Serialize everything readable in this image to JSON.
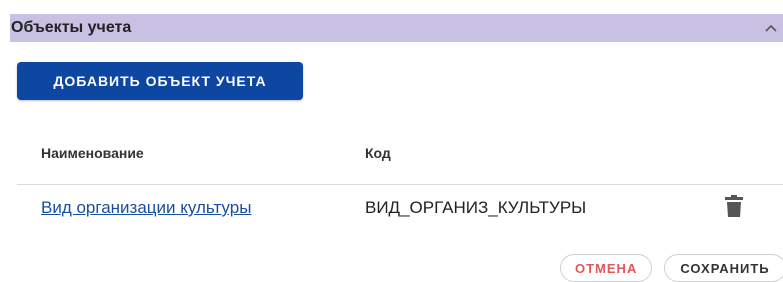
{
  "section": {
    "title": "Объекты учета",
    "collapse_icon": "chevron-up-icon"
  },
  "actions": {
    "add_label": "ДОБАВИТЬ ОБЪЕКТ УЧЕТА"
  },
  "table": {
    "columns": [
      "Наименование",
      "Код"
    ],
    "rows": [
      {
        "name": "Вид организации культуры",
        "code": "ВИД_ОРГАНИЗ_КУЛЬТУРЫ",
        "action_icon": "trash-icon"
      }
    ]
  },
  "footer": {
    "cancel_label": "ОТМЕНА",
    "save_label": "СОХРАНИТЬ"
  },
  "colors": {
    "header_bg": "#c9c1e3",
    "primary": "#0d47a1",
    "link": "#1a4fa0",
    "cancel": "#e0585a"
  }
}
